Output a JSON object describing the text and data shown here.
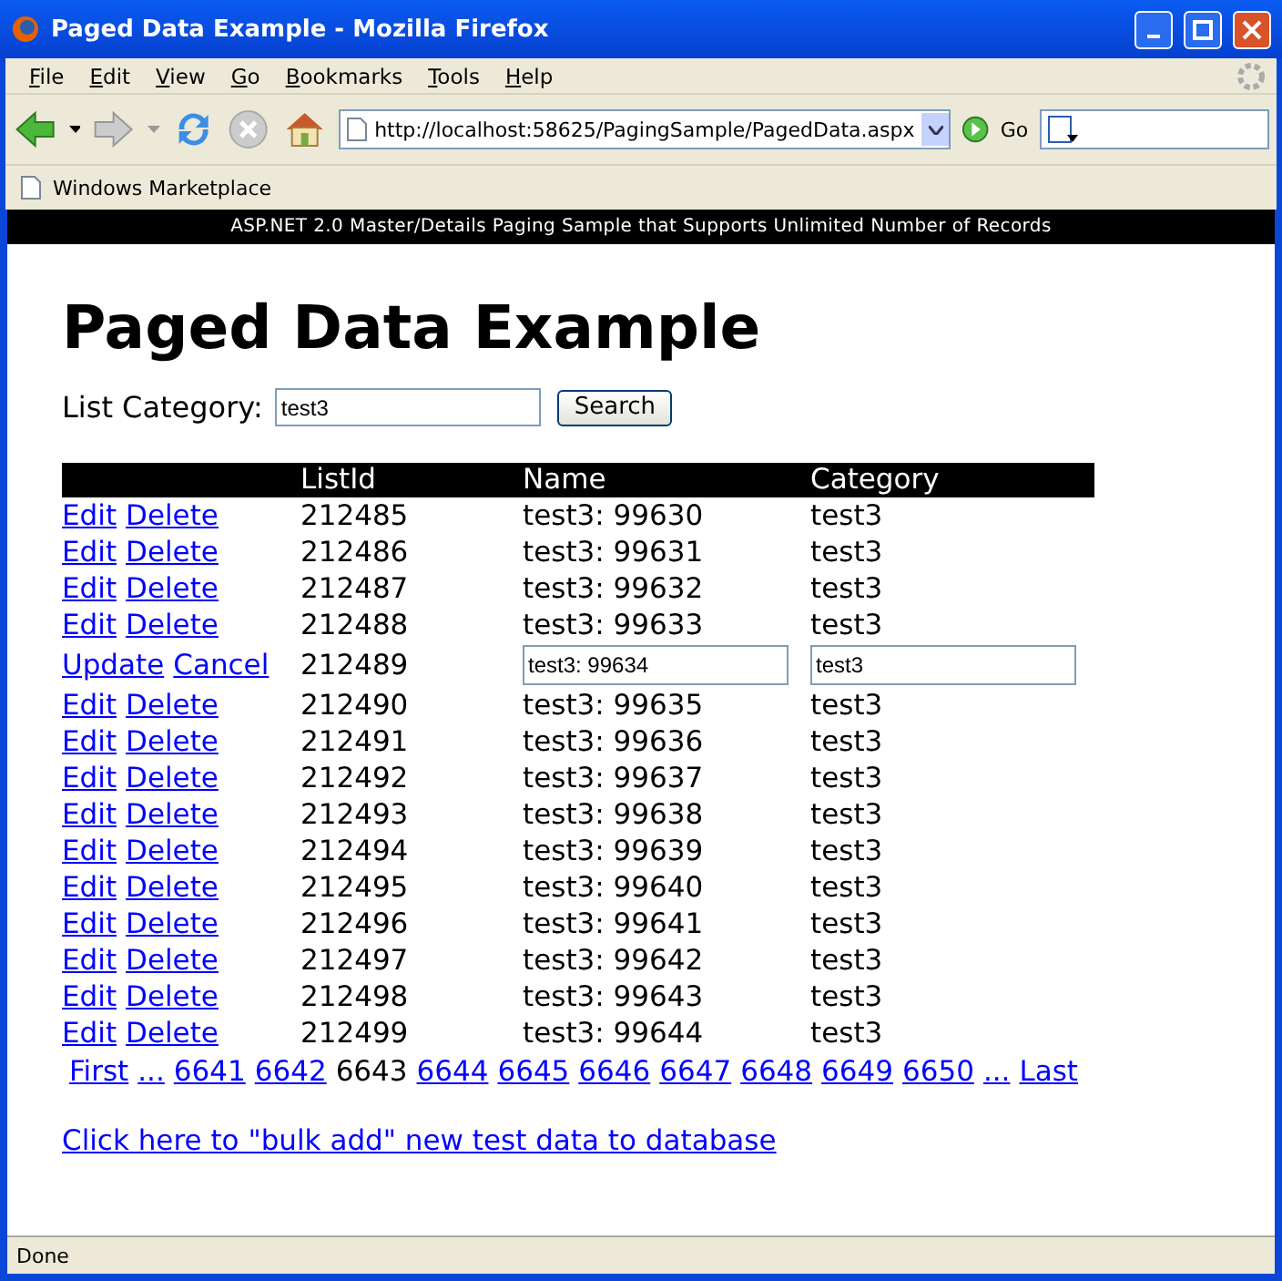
{
  "window": {
    "title": "Paged Data Example - Mozilla Firefox"
  },
  "menu": [
    "File",
    "Edit",
    "View",
    "Go",
    "Bookmarks",
    "Tools",
    "Help"
  ],
  "address": {
    "url": "http://localhost:58625/PagingSample/PagedData.aspx",
    "go": "Go"
  },
  "bookmarks": [
    "Windows Marketplace"
  ],
  "banner": "ASP.NET 2.0 Master/Details Paging Sample that Supports Unlimited Number of Records",
  "page": {
    "heading": "Paged Data Example",
    "search_label": "List Category:",
    "search_value": "test3",
    "search_button": "Search"
  },
  "table": {
    "columns": [
      "ListId",
      "Name",
      "Category"
    ],
    "rows": [
      {
        "kind": "view",
        "actions": [
          "Edit",
          "Delete"
        ],
        "id": "212485",
        "name": "test3: 99630",
        "category": "test3"
      },
      {
        "kind": "view",
        "actions": [
          "Edit",
          "Delete"
        ],
        "id": "212486",
        "name": "test3: 99631",
        "category": "test3"
      },
      {
        "kind": "view",
        "actions": [
          "Edit",
          "Delete"
        ],
        "id": "212487",
        "name": "test3: 99632",
        "category": "test3"
      },
      {
        "kind": "view",
        "actions": [
          "Edit",
          "Delete"
        ],
        "id": "212488",
        "name": "test3: 99633",
        "category": "test3"
      },
      {
        "kind": "edit",
        "actions": [
          "Update",
          "Cancel"
        ],
        "id": "212489",
        "name": "test3: 99634",
        "category": "test3"
      },
      {
        "kind": "view",
        "actions": [
          "Edit",
          "Delete"
        ],
        "id": "212490",
        "name": "test3: 99635",
        "category": "test3"
      },
      {
        "kind": "view",
        "actions": [
          "Edit",
          "Delete"
        ],
        "id": "212491",
        "name": "test3: 99636",
        "category": "test3"
      },
      {
        "kind": "view",
        "actions": [
          "Edit",
          "Delete"
        ],
        "id": "212492",
        "name": "test3: 99637",
        "category": "test3"
      },
      {
        "kind": "view",
        "actions": [
          "Edit",
          "Delete"
        ],
        "id": "212493",
        "name": "test3: 99638",
        "category": "test3"
      },
      {
        "kind": "view",
        "actions": [
          "Edit",
          "Delete"
        ],
        "id": "212494",
        "name": "test3: 99639",
        "category": "test3"
      },
      {
        "kind": "view",
        "actions": [
          "Edit",
          "Delete"
        ],
        "id": "212495",
        "name": "test3: 99640",
        "category": "test3"
      },
      {
        "kind": "view",
        "actions": [
          "Edit",
          "Delete"
        ],
        "id": "212496",
        "name": "test3: 99641",
        "category": "test3"
      },
      {
        "kind": "view",
        "actions": [
          "Edit",
          "Delete"
        ],
        "id": "212497",
        "name": "test3: 99642",
        "category": "test3"
      },
      {
        "kind": "view",
        "actions": [
          "Edit",
          "Delete"
        ],
        "id": "212498",
        "name": "test3: 99643",
        "category": "test3"
      },
      {
        "kind": "view",
        "actions": [
          "Edit",
          "Delete"
        ],
        "id": "212499",
        "name": "test3: 99644",
        "category": "test3"
      }
    ]
  },
  "pager": [
    {
      "label": "First",
      "selected": false
    },
    {
      "label": "...",
      "selected": false
    },
    {
      "label": "6641",
      "selected": false
    },
    {
      "label": "6642",
      "selected": false
    },
    {
      "label": "6643",
      "selected": true
    },
    {
      "label": "6644",
      "selected": false
    },
    {
      "label": "6645",
      "selected": false
    },
    {
      "label": "6646",
      "selected": false
    },
    {
      "label": "6647",
      "selected": false
    },
    {
      "label": "6648",
      "selected": false
    },
    {
      "label": "6649",
      "selected": false
    },
    {
      "label": "6650",
      "selected": false
    },
    {
      "label": "...",
      "selected": false
    },
    {
      "label": "Last",
      "selected": false
    }
  ],
  "bulk_link": "Click here to \"bulk add\" new test data to database",
  "status_bar": "Done"
}
